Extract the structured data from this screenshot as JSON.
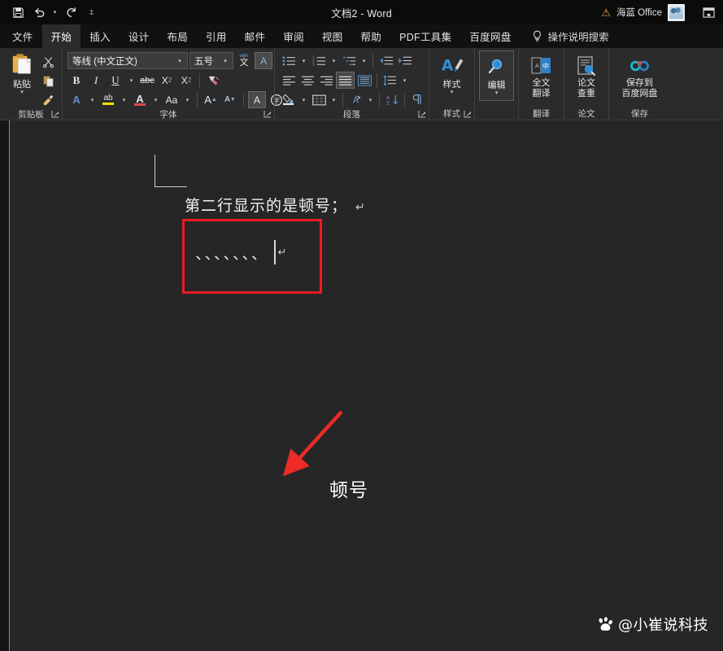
{
  "titlebar": {
    "quick_access": [
      {
        "name": "save",
        "label": "保存",
        "icon": "save-icon"
      },
      {
        "name": "undo",
        "label": "撤销",
        "icon": "undo-icon"
      },
      {
        "name": "redo",
        "label": "恢复",
        "icon": "redo-icon"
      },
      {
        "name": "customize",
        "label": "自定义快速访问工具栏",
        "icon": "chevron-down-icon"
      }
    ],
    "document_title": "文档2  -  Word",
    "account_name": "海蓝 Office",
    "warning_icon": "warning-triangle-icon",
    "avatar_icon": "user-avatar",
    "ribbon_display_icon": "ribbon-display-options-icon"
  },
  "tabs": [
    {
      "label": "文件",
      "active": false
    },
    {
      "label": "开始",
      "active": true
    },
    {
      "label": "插入",
      "active": false
    },
    {
      "label": "设计",
      "active": false
    },
    {
      "label": "布局",
      "active": false
    },
    {
      "label": "引用",
      "active": false
    },
    {
      "label": "邮件",
      "active": false
    },
    {
      "label": "审阅",
      "active": false
    },
    {
      "label": "视图",
      "active": false
    },
    {
      "label": "帮助",
      "active": false
    },
    {
      "label": "PDF工具集",
      "active": false
    },
    {
      "label": "百度网盘",
      "active": false
    }
  ],
  "tell_me": {
    "label": "操作说明搜索",
    "icon": "lightbulb-icon"
  },
  "ribbon": {
    "clipboard": {
      "group_label": "剪贴板",
      "paste_label": "粘贴",
      "paste_caret": "⌄",
      "buttons": [
        {
          "name": "cut",
          "label": "剪切",
          "icon": "scissors-icon"
        },
        {
          "name": "copy",
          "label": "复制",
          "icon": "copy-icon"
        },
        {
          "name": "format-painter",
          "label": "格式刷",
          "icon": "format-painter-icon"
        }
      ],
      "launcher": "剪贴板对话框启动器"
    },
    "font": {
      "group_label": "字体",
      "font_name": "等线 (中文正文)",
      "font_size": "五号",
      "caret": "⌄",
      "row1": [
        {
          "name": "phonetic-guide",
          "label": "拼音指南",
          "icon": "phonetic-guide-icon"
        },
        {
          "name": "character-border-top",
          "label": "字符边框",
          "icon": "char-border-icon"
        }
      ],
      "row2": [
        {
          "name": "bold",
          "label": "B"
        },
        {
          "name": "italic",
          "label": "I"
        },
        {
          "name": "underline",
          "label": "U"
        },
        {
          "name": "strikethrough",
          "label": "abc"
        },
        {
          "name": "subscript",
          "label": "X₂"
        },
        {
          "name": "superscript",
          "label": "X²"
        },
        {
          "name": "clear-formatting",
          "label": "清除所有格式"
        }
      ],
      "row3": [
        {
          "name": "text-effects",
          "label": "文本效果和版式"
        },
        {
          "name": "text-highlight-color",
          "label": "文本突出显示颜色"
        },
        {
          "name": "font-color",
          "label": "字体颜色"
        },
        {
          "name": "change-case",
          "label": "Aa"
        },
        {
          "name": "grow-font",
          "label": "增大字号"
        },
        {
          "name": "shrink-font",
          "label": "减小字号"
        },
        {
          "name": "character-border",
          "label": "字符边框"
        },
        {
          "name": "enclose-characters",
          "label": "带圈字符"
        }
      ],
      "launcher": "字体对话框启动器"
    },
    "paragraph": {
      "group_label": "段落",
      "row1": [
        {
          "name": "bullets",
          "label": "项目符号"
        },
        {
          "name": "numbering",
          "label": "编号"
        },
        {
          "name": "multilevel-list",
          "label": "多级列表"
        },
        {
          "name": "decrease-indent",
          "label": "减少缩进量"
        },
        {
          "name": "increase-indent",
          "label": "增加缩进量"
        }
      ],
      "row2": [
        {
          "name": "align-left",
          "label": "左对齐",
          "active": false
        },
        {
          "name": "align-center",
          "label": "居中",
          "active": false
        },
        {
          "name": "align-right",
          "label": "右对齐",
          "active": false
        },
        {
          "name": "justify",
          "label": "两端对齐",
          "active": true
        },
        {
          "name": "distributed",
          "label": "分散对齐",
          "active": false
        },
        {
          "name": "line-spacing",
          "label": "行和段落间距",
          "active": false
        }
      ],
      "row3": [
        {
          "name": "shading",
          "label": "底纹"
        },
        {
          "name": "borders",
          "label": "边框"
        },
        {
          "name": "asian-layout",
          "label": "中文版式"
        },
        {
          "name": "sort",
          "label": "排序"
        },
        {
          "name": "show-formatting-marks",
          "label": "显示/隐藏编辑标记"
        }
      ],
      "launcher": "段落对话框启动器"
    },
    "styles": {
      "group_label": "样式",
      "button_label": "样式",
      "caret": "⌄",
      "icon": "styles-icon",
      "launcher": "样式对话框启动器"
    },
    "editing": {
      "group_label": "",
      "button_label": "编辑",
      "caret": "⌄",
      "icon": "magnifier-icon"
    },
    "translate": {
      "group_label": "翻译",
      "button_label_line1": "全文",
      "button_label_line2": "翻译",
      "icon": "translate-icon"
    },
    "thesis": {
      "group_label": "论文",
      "button_label_line1": "论文",
      "button_label_line2": "查重",
      "icon": "thesis-check-icon"
    },
    "save_group": {
      "group_label": "保存",
      "button_label_line1": "保存到",
      "button_label_line2": "百度网盘",
      "icon": "baidu-netdisk-icon"
    }
  },
  "document": {
    "line1_text": "第二行显示的是顿号；",
    "line1_paragraph_mark": "↵",
    "dunhao_marks": "、、、、、、、",
    "dunhao_return_mark": "↵",
    "annotation_label": "顿号",
    "annotation_arrow": "red-arrow",
    "highlight_box": "red-rectangle",
    "crop_mark": "page-corner-mark"
  },
  "watermark": {
    "text": "@小崔说科技",
    "icon": "baidu-paw-icon"
  },
  "colors": {
    "accent_red": "#ec1c24",
    "ribbon_bg": "#2b2b2b",
    "titlebar_bg": "#0b0b0b",
    "page_bg": "#262626",
    "active_tab_bg": "#2b2b2b",
    "icon_blue": "#4f9ee0",
    "highlight_yellow": "#f2e205",
    "font_color_red": "#e04a4a"
  }
}
